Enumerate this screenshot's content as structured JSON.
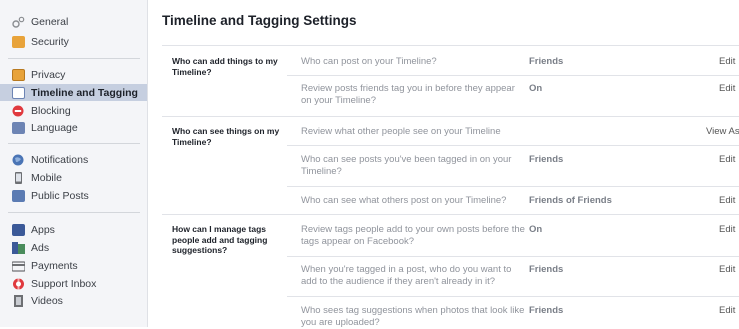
{
  "sidebar": {
    "items": [
      {
        "label": "General",
        "icon": "general-gear-icon",
        "color": "#8a8d91"
      },
      {
        "label": "Security",
        "icon": "security-badge-icon",
        "color": "#e8a33a"
      },
      {
        "label": "Privacy",
        "icon": "privacy-lock-icon",
        "color": "#e8a33a"
      },
      {
        "label": "Timeline and Tagging",
        "icon": "timeline-icon",
        "color": "#6d84b4",
        "active": true
      },
      {
        "label": "Blocking",
        "icon": "blocking-icon",
        "color": "#e0393e"
      },
      {
        "label": "Language",
        "icon": "language-icon",
        "color": "#6d84b4"
      },
      {
        "label": "Notifications",
        "icon": "notifications-globe-icon",
        "color": "#4a74b5"
      },
      {
        "label": "Mobile",
        "icon": "mobile-phone-icon",
        "color": "#6d6f73"
      },
      {
        "label": "Public Posts",
        "icon": "public-posts-icon",
        "color": "#5b7bb3"
      },
      {
        "label": "Apps",
        "icon": "apps-icon",
        "color": "#3b5998"
      },
      {
        "label": "Ads",
        "icon": "ads-icon",
        "color": "#4a8c5c"
      },
      {
        "label": "Payments",
        "icon": "payments-card-icon",
        "color": "#6d6f73"
      },
      {
        "label": "Support Inbox",
        "icon": "support-lifebuoy-icon",
        "color": "#e0393e"
      },
      {
        "label": "Videos",
        "icon": "videos-film-icon",
        "color": "#6d6f73"
      }
    ]
  },
  "main": {
    "title": "Timeline and Tagging Settings",
    "sections": [
      {
        "label": "Who can add things to my Timeline?",
        "rows": [
          {
            "question": "Who can post on your Timeline?",
            "value": "Friends",
            "action": "Edit"
          },
          {
            "question": "Review posts friends tag you in before they appear on your Timeline?",
            "value": "On",
            "action": "Edit"
          }
        ]
      },
      {
        "label": "Who can see things on my Timeline?",
        "rows": [
          {
            "question": "Review what other people see on your Timeline",
            "value": "",
            "action": "View As"
          },
          {
            "question": "Who can see posts you've been tagged in on your Timeline?",
            "value": "Friends",
            "action": "Edit"
          },
          {
            "question": "Who can see what others post on your Timeline?",
            "value": "Friends of Friends",
            "action": "Edit"
          }
        ]
      },
      {
        "label": "How can I manage tags people add and tagging suggestions?",
        "rows": [
          {
            "question": "Review tags people add to your own posts before the tags appear on Facebook?",
            "value": "On",
            "action": "Edit"
          },
          {
            "question": "When you're tagged in a post, who do you want to add to the audience if they aren't already in it?",
            "value": "Friends",
            "action": "Edit"
          },
          {
            "question": "Who sees tag suggestions when photos that look like you are uploaded?",
            "value": "Friends",
            "action": "Edit"
          }
        ]
      }
    ]
  }
}
